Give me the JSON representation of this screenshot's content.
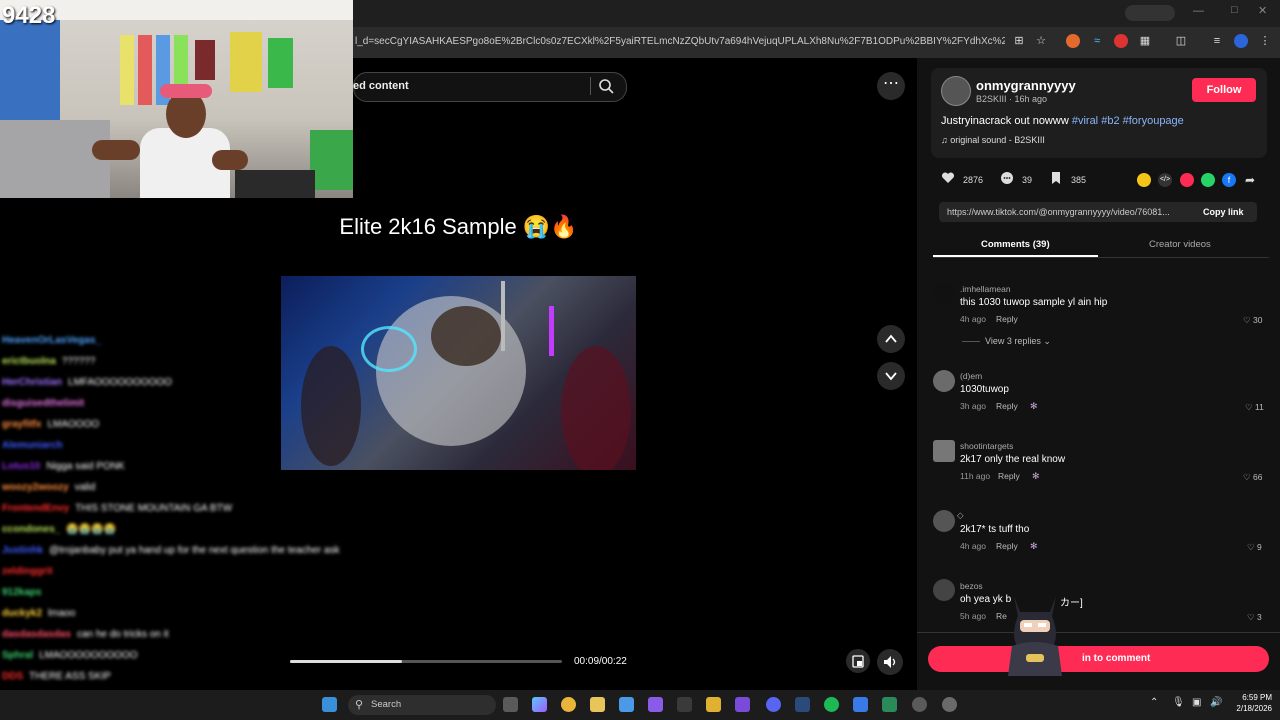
{
  "browser": {
    "url": "l_d=secCgYIASAHKAESPgo8oE%2BrClc0s0z7ECXkl%2F5yaiRTELmcNzZQbUtv7a694hVejuqUPLALXh8Nu%2F7B1ODPu%2BBIY%2FYdhXc%2FpwIGGgA%3D&_r..."
  },
  "search": {
    "text": "ed content",
    "icon": "search-icon"
  },
  "video": {
    "title": "Elite 2k16 Sample 😭🔥",
    "time": "00:09/00:22",
    "progress_fraction": 0.41,
    "buffered_fraction": 0.2
  },
  "author": {
    "username": "onmygrannyyyy",
    "meta": "B2SKIII · 16h ago",
    "follow_label": "Follow",
    "caption": "Justryinacrack out nowww",
    "tags": [
      "#viral",
      "#b2",
      "#foryoupage"
    ],
    "sound": "original sound - B2SKIII"
  },
  "actions": {
    "likes": "2876",
    "comments": "39",
    "saves": "385"
  },
  "share": {
    "link": "https://www.tiktok.com/@onmygrannyyyy/video/76081...",
    "copy_label": "Copy link"
  },
  "tabs": {
    "comments": "Comments (39)",
    "creator": "Creator videos"
  },
  "comments": [
    {
      "user": ".imhellamean",
      "text": "this 1030 tuwop sample yl ain hip",
      "age": "4h ago",
      "reply": "Reply",
      "likes": "30"
    },
    {
      "user": "(d)em",
      "text": "1030tuwop",
      "age": "3h ago",
      "reply": "Reply",
      "likes": "11"
    },
    {
      "user": "shootintargets",
      "text": "2k17 only the real know",
      "age": "11h ago",
      "reply": "Reply",
      "likes": "66"
    },
    {
      "user": "◇",
      "text": "2k17* ts tuff tho",
      "age": "4h ago",
      "reply": "Reply",
      "likes": "9"
    },
    {
      "user": "bezos",
      "text": "oh yea yk b",
      "text_tail": "カー]",
      "age": "5h ago",
      "reply": "Re",
      "likes": "3"
    }
  ],
  "view_replies": "View 3 replies",
  "login": {
    "label": "in to comment"
  },
  "stream": {
    "viewer_count": "9428",
    "chat": [
      {
        "user": "HeavenOrLasVegas_",
        "msg": "",
        "color": "#4fa3ff"
      },
      {
        "user": "erictbuolna",
        "msg": "??????",
        "color": "#b8e25a"
      },
      {
        "user": "HerChristian",
        "msg": "LMFAOOOOOOOOOO",
        "color": "#a070ff"
      },
      {
        "user": "disguisedthelimit",
        "msg": "",
        "color": "#e070e0"
      },
      {
        "user": "grayfitfx",
        "msg": "LMAOOOO",
        "color": "#ff8a3d"
      },
      {
        "user": "Alemuniarch",
        "msg": "",
        "color": "#3d5bff"
      },
      {
        "user": "Lotus10",
        "msg": "Nigga said PONK",
        "color": "#8a2be2"
      },
      {
        "user": "woozy2woozy",
        "msg": "valid",
        "color": "#ff8a3d"
      },
      {
        "user": "FrontendEnvy",
        "msg": "THIS STONE MOUNTAIN GA BTW",
        "color": "#ff2a2a"
      },
      {
        "user": "ccondones_",
        "msg": "😭😭😭😭",
        "color": "#b8e25a"
      },
      {
        "user": "Justinhk",
        "msg": "@trojanbaby put ya hand up for the next question the teacher ask",
        "color": "#3d5bff"
      },
      {
        "user": "zeldinggrit",
        "msg": "",
        "color": "#ff2a2a"
      },
      {
        "user": "912kaps",
        "msg": "",
        "color": "#3dd16e"
      },
      {
        "user": "duckyk2",
        "msg": "lmaoo",
        "color": "#ffd23d"
      },
      {
        "user": "dasdasdasdas",
        "msg": "can he do tricks on it",
        "color": "#ff4d6a"
      },
      {
        "user": "Sphral",
        "msg": "LMAOOOOOOOOOO",
        "color": "#3dd16e"
      },
      {
        "user": "DDS",
        "msg": "THERE ASS SKIP",
        "color": "#ff2a2a"
      }
    ]
  },
  "taskbar": {
    "search_placeholder": "Search",
    "time": "6:59 PM",
    "date": "2/18/2026"
  },
  "colors": {
    "accent": "#fe2c55",
    "link": "#8ab4f8",
    "panel": "#121212"
  }
}
